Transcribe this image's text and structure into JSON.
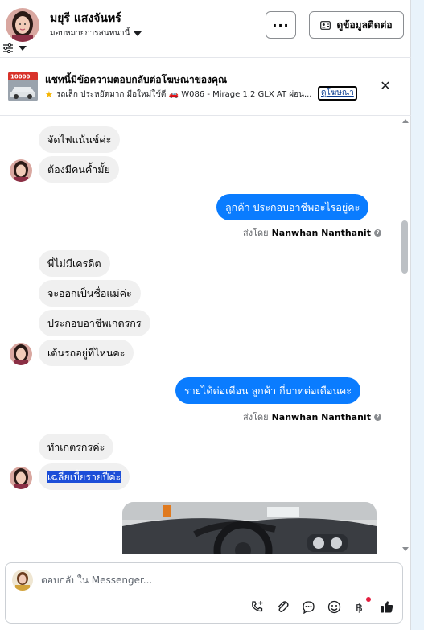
{
  "header": {
    "contact_name": "มยุรี แสงจันทร์",
    "assign_label": "มอบหมายการสนทนานี้",
    "more_label": "···",
    "contact_info_label": "ดูข้อมูลติดต่อ"
  },
  "ad_banner": {
    "title": "แชทนี้มีข้อความตอบกลับต่อโฆษณาของคุณ",
    "subtitle": "รถเล็ก ประหยัดมาก มือใหม่ใช้ดี 🚗 W086 - Mirage 1.2 GLX AT ผ่อน...",
    "thumb_text": "10000",
    "view_ad_label": "ดูโฆษณา"
  },
  "messages": [
    {
      "side": "in",
      "text": "จัดไฟแน้นช์ค่ะ"
    },
    {
      "side": "in",
      "text": "ต้องมีคนค้ำมั้ย"
    },
    {
      "side": "out",
      "text": "ลูกค้า ประกอบอาชีพอะไรอยู่คะ"
    },
    {
      "side": "in",
      "text": "พี่ไม่มีเครดิต"
    },
    {
      "side": "in",
      "text": "จะออกเป็นชื่อแม่ค่ะ"
    },
    {
      "side": "in",
      "text": "ประกอบอาชีพเกตรกร"
    },
    {
      "side": "in",
      "text": "เต้นรถอยู่ที่ไหนคะ"
    },
    {
      "side": "out",
      "text": "รายได้ต่อเดือน  ลูกค้า กี่บาทต่อเดือนคะ"
    },
    {
      "side": "in",
      "text": "ทำเกตรกรค่ะ"
    },
    {
      "side": "in",
      "text": "เฉลี่ยเบี้ยรายปีค่ะ"
    }
  ],
  "sent_by": {
    "prefix": "ส่งโดย",
    "name": "Nanwhan Nanthanit"
  },
  "composer": {
    "placeholder": "ตอบกลับใน Messenger..."
  },
  "colors": {
    "outgoing_bubble": "#0a7cff",
    "incoming_bubble": "#f0f0f0",
    "selection": "#1c4ed8"
  },
  "icons": {
    "filter": "sliders-icon",
    "contact_card": "contact-card-icon",
    "close": "close-icon",
    "star": "star-emoji",
    "phone": "phone-plus-icon",
    "attach": "paperclip-icon",
    "chat": "chat-bubble-icon",
    "emoji": "smiley-icon",
    "baht": "baht-icon",
    "like": "thumbs-up-icon"
  }
}
